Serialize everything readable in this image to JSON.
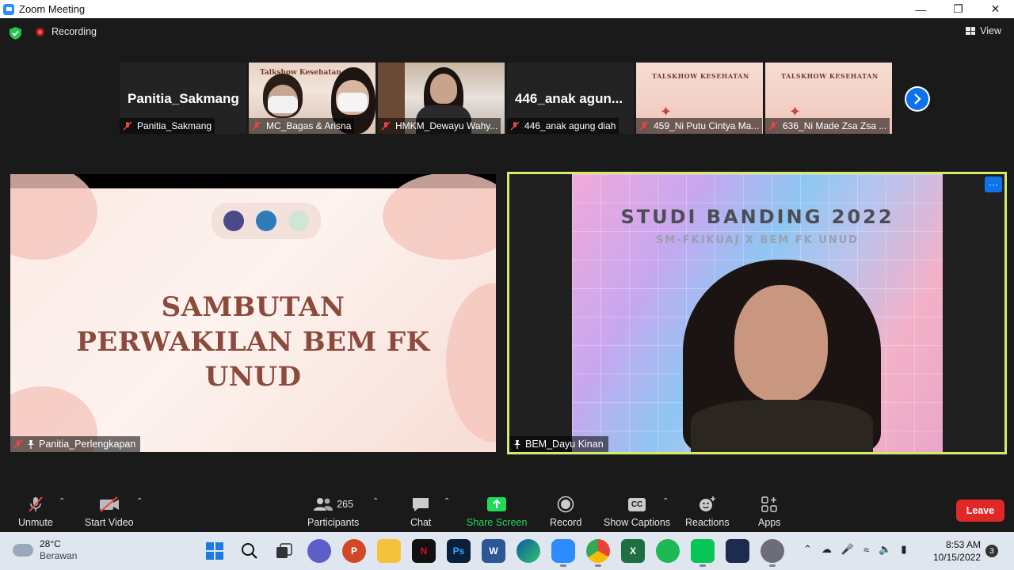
{
  "window": {
    "title": "Zoom Meeting"
  },
  "meeting_bar": {
    "recording_label": "Recording",
    "view_label": "View"
  },
  "thumbnails": [
    {
      "name": "Panitia_Sakmang",
      "display_name": "Panitia_Sakmang",
      "type": "name",
      "muted": true
    },
    {
      "name": "MC_Bagas & Arisna",
      "type": "camera",
      "muted": true
    },
    {
      "name": "HMKM_Dewayu Wahy...",
      "type": "camera",
      "muted": true
    },
    {
      "name": "446_anak agung diah",
      "display_name": "446_anak  agun...",
      "type": "name",
      "muted": true
    },
    {
      "name": "459_Ni Putu Cintya Ma...",
      "type": "slide",
      "slide_text": "TALSKHOW KESEHATAN",
      "muted": true
    },
    {
      "name": "636_Ni Made Zsa Zsa ...",
      "type": "slide",
      "slide_text": "TALSKHOW KESEHATAN",
      "muted": true
    }
  ],
  "thumb1_slide_text": "Talkshow Kesehatan",
  "main_left": {
    "participant": "Panitia_Perlengkapan",
    "slide_lines": [
      "SAMBUTAN",
      "PERWAKILAN BEM FK",
      "UNUD"
    ]
  },
  "main_right": {
    "participant": "BEM_Dayu Kinan",
    "bg_title": "STUDI BANDING 2022",
    "bg_subtitle": "SM-FKIKUAJ X BEM FK UNUD",
    "more_label": "···"
  },
  "toolbar": {
    "unmute": "Unmute",
    "start_video": "Start Video",
    "participants_count": "265",
    "participants": "Participants",
    "chat": "Chat",
    "share_screen": "Share Screen",
    "record": "Record",
    "show_captions": "Show Captions",
    "captions_badge": "CC",
    "reactions": "Reactions",
    "apps": "Apps",
    "leave": "Leave"
  },
  "taskbar": {
    "temperature": "28°C",
    "weather": "Berawan",
    "time": "8:53 AM",
    "date": "10/15/2022",
    "notifications": "3"
  },
  "colors": {
    "accent_blue": "#0e72ed",
    "share_green": "#23d959",
    "leave_red": "#e02828",
    "active_speaker_border": "#d6ea6a"
  }
}
